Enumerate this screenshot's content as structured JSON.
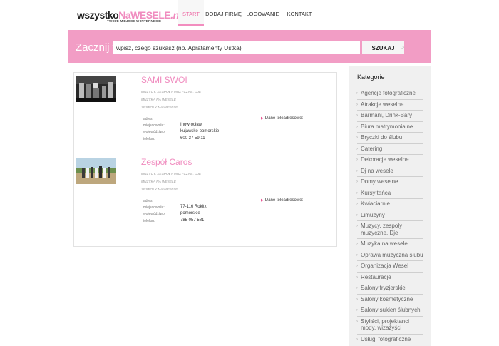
{
  "logo": {
    "part1": "wszystko",
    "part2": "NaWESELE",
    "part3": ".net",
    "tagline": "TWOJE MIEJSCE W INTERNECIE"
  },
  "nav": {
    "items": [
      "START",
      "DODAJ FIRMĘ",
      "LOGOWANIE",
      "KONTAKT"
    ]
  },
  "search": {
    "label": "Zacznij tu",
    "value": "wpisz, czego szukasz (np. Apratamenty Ustka)",
    "button": "SZUKAJ"
  },
  "results": [
    {
      "name": "SAMI SWOI",
      "cats": [
        "MUZYCY, ZESPOŁY MUZYCZNE, DJE",
        "MUZYKA NA WESELE",
        "ZESPOŁY NA WESELE"
      ],
      "labels": {
        "address": "adres:",
        "city": "miejscowość:",
        "region": "województwo:",
        "phone": "telefon:"
      },
      "city": "Inowrocław",
      "region": "kujawsko-pomorskie",
      "phone": "600 37 59 11",
      "contact": "Dane teleadresowe:"
    },
    {
      "name": "Zespół Caros",
      "cats": [
        "MUZYCY, ZESPOŁY MUZYCZNE, DJE",
        "MUZYKA NA WESELE",
        "ZESPOŁY NA WESELE"
      ],
      "labels": {
        "address": "adres:",
        "city": "miejscowość:",
        "region": "województwo:",
        "phone": "telefon:"
      },
      "city": "77-116 Rokitki",
      "region": "pomorskie",
      "phone": "785 057 581",
      "contact": "Dane teleadresowe:"
    }
  ],
  "sidebar": {
    "title": "Kategorie",
    "items": [
      "Agencje fotograficzne",
      "Atrakcje weselne",
      "Barmani, Drink-Bary",
      "Biura matrymonialne",
      "Bryczki do ślubu",
      "Catering",
      "Dekoracje weselne",
      "Dj na wesele",
      "Domy weselne",
      "Kursy tańca",
      "Kwiaciarnie",
      "Limuzyny",
      "Muzycy, zespoły muzyczne, Dje",
      "Muzyka na wesele",
      "Oprawa muzyczna ślubu",
      "Organizacja Wesel",
      "Restauracje",
      "Salony fryzjerskie",
      "Salony kosmetyczne",
      "Salony sukien ślubnych",
      "Styliści, projektanci mody, wizażyści",
      "Usługi fotograficzne"
    ]
  }
}
